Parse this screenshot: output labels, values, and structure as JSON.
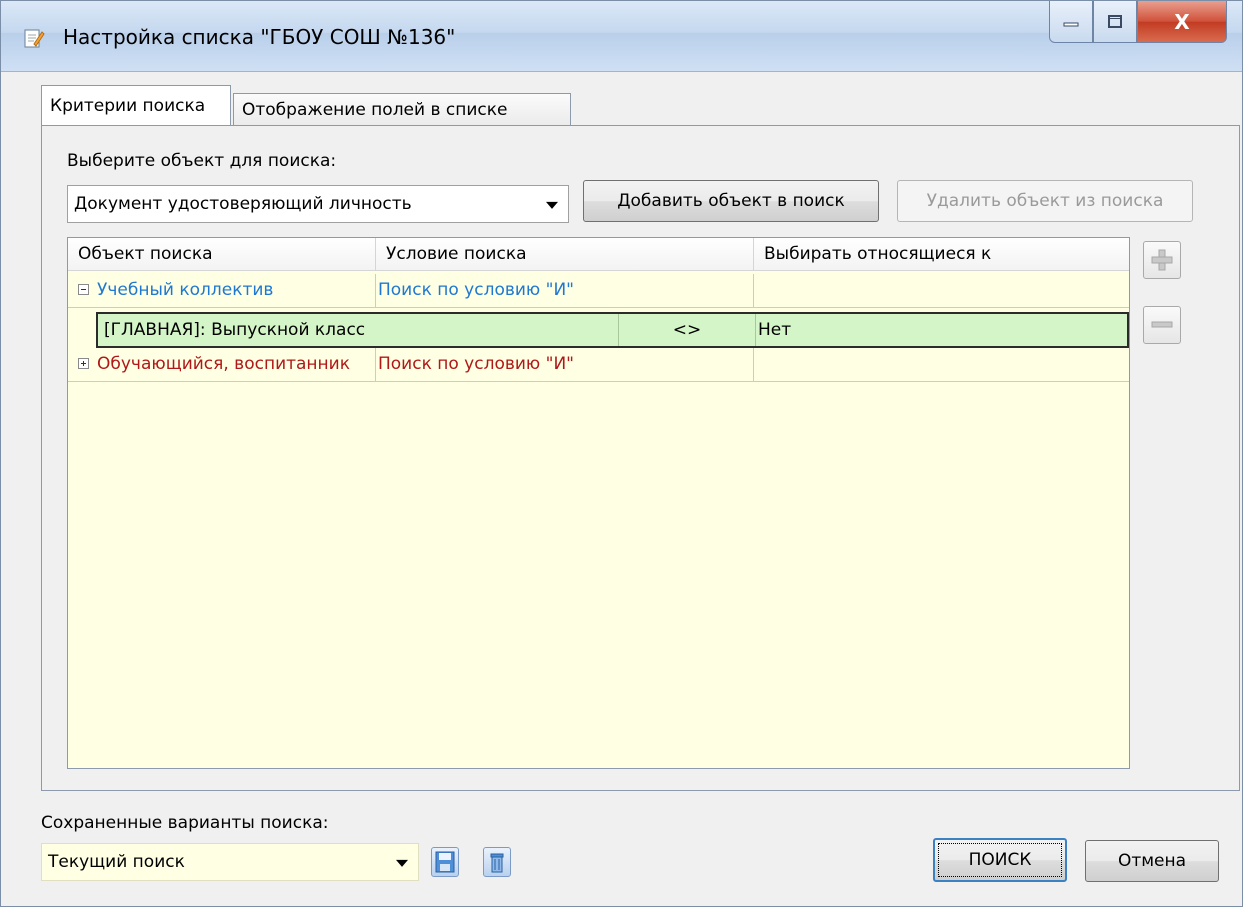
{
  "window": {
    "title": "Настройка списка  \"ГБОУ СОШ №136\"",
    "close_label": "X"
  },
  "tabs": [
    {
      "label": "Критерии поиска",
      "active": true
    },
    {
      "label": "Отображение полей в списке",
      "active": false
    }
  ],
  "search_object": {
    "label": "Выберите объект для поиска:",
    "selected": "Документ удостоверяющий личность"
  },
  "buttons": {
    "add_object": "Добавить объект в поиск",
    "remove_object": "Удалить объект из поиска",
    "search": "ПОИСК",
    "cancel": "Отмена"
  },
  "grid": {
    "columns": [
      "Объект поиска",
      "Условие поиска",
      "Выбирать относящиеся к"
    ],
    "rows": [
      {
        "object": "Учебный коллектив",
        "condition": "Поиск по условию \"И\"",
        "relates": "",
        "expanded": true,
        "color": "#1e78d2"
      },
      {
        "object": "Обучающийся, воспитанник",
        "condition": "Поиск по условию \"И\"",
        "relates": "",
        "expanded": false,
        "color": "#b01818"
      }
    ],
    "selected_condition": {
      "field": "[ГЛАВНАЯ]: Выпускной класс",
      "operator": "<>",
      "value": "Нет"
    },
    "background": "#ffffe4",
    "selected_background": "#d4f5c8"
  },
  "saved": {
    "label": "Сохраненные варианты поиска:",
    "selected": "Текущий поиск"
  }
}
